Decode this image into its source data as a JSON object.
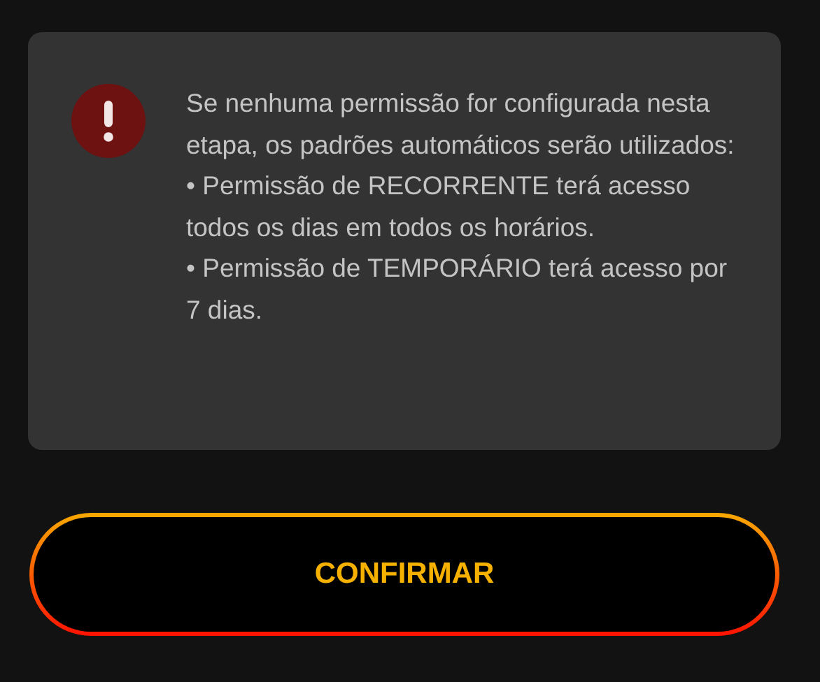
{
  "notice": {
    "intro": "Se nenhuma permissão for configurada nesta etapa, os padrões automáticos serão utilizados:",
    "bullets": [
      "• Permissão de RECORRENTE terá acesso todos os dias em todos os horários.",
      "• Permissão de TEMPORÁRIO terá acesso por 7 dias."
    ]
  },
  "confirm_button": {
    "label": "CONFIRMAR"
  }
}
